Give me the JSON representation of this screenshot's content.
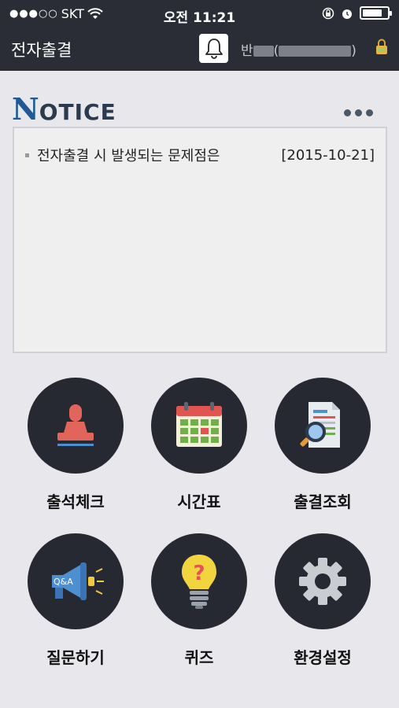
{
  "status_bar": {
    "carrier": "SKT",
    "time": "오전 11:21"
  },
  "header": {
    "title": "전자출결",
    "user_prefix": "반",
    "user_open": "(",
    "user_close": ")",
    "icons": {
      "bell": "bell-icon",
      "lock": "lock-icon"
    }
  },
  "notice": {
    "title_big": "N",
    "title_rest": "OTICE",
    "items": [
      {
        "text": "전자출결 시 발생되는 문제점은",
        "date": "[2015-10-21]"
      }
    ]
  },
  "menu": [
    {
      "label": "출석체크",
      "icon": "stamp-icon"
    },
    {
      "label": "시간표",
      "icon": "calendar-icon"
    },
    {
      "label": "출결조회",
      "icon": "document-search-icon"
    },
    {
      "label": "질문하기",
      "icon": "megaphone-qa-icon"
    },
    {
      "label": "퀴즈",
      "icon": "lightbulb-question-icon"
    },
    {
      "label": "환경설정",
      "icon": "gear-icon"
    }
  ],
  "colors": {
    "header_bg": "#2a2d35",
    "accent": "#1f5a96",
    "circle_bg": "#262932"
  }
}
